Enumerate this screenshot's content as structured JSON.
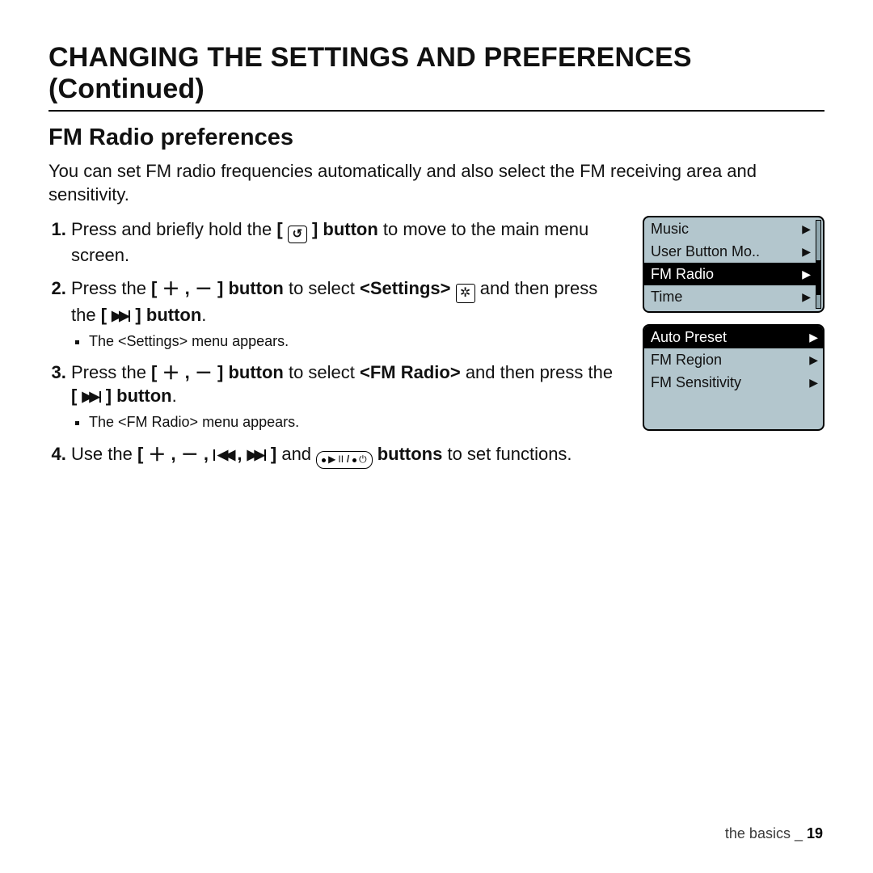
{
  "page": {
    "title": "CHANGING THE SETTINGS AND PREFERENCES (Continued)",
    "section": "FM Radio preferences",
    "intro": "You can set FM radio frequencies automatically and also select the FM receiving area and sensitivity."
  },
  "steps": {
    "s1_a": "Press and briefly hold the ",
    "s1_b": " button",
    "s1_c": " to move to the main menu screen.",
    "s2_a": "Press the ",
    "s2_b": " button",
    "s2_c": " to select ",
    "s2_d": "<Settings>",
    "s2_e": " and then press the ",
    "s2_f": " button",
    "s2_bullet": "The <Settings> menu appears.",
    "s3_a": "Press the ",
    "s3_b": " button",
    "s3_c": " to select ",
    "s3_d": "<FM Radio>",
    "s3_e": " and then press the ",
    "s3_f": " button",
    "s3_bullet": "The <FM Radio> menu appears.",
    "s4_a": "Use the ",
    "s4_b": " and ",
    "s4_c": " buttons",
    "s4_d": " to set functions."
  },
  "glyphs": {
    "plus": "＋",
    "minus": "－",
    "comma": " , ",
    "lbr": "[ ",
    "rbr": " ]",
    "dot": "."
  },
  "screen1": {
    "items": [
      {
        "label": "Music",
        "selected": false
      },
      {
        "label": "User Button Mo..",
        "selected": false
      },
      {
        "label": "FM Radio",
        "selected": true
      },
      {
        "label": "Time",
        "selected": false
      }
    ],
    "thumb_top_pct": 45,
    "thumb_h_pct": 40
  },
  "screen2": {
    "items": [
      {
        "label": "Auto Preset",
        "selected": true
      },
      {
        "label": "FM Region",
        "selected": false
      },
      {
        "label": "FM Sensitivity",
        "selected": false
      }
    ]
  },
  "footer": {
    "section": "the basics",
    "sep": " _ ",
    "page": "19"
  }
}
